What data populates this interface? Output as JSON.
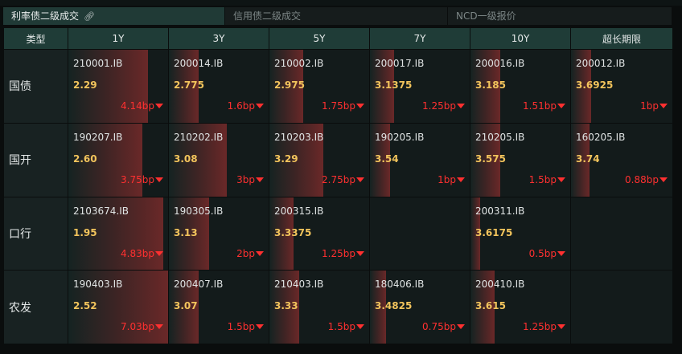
{
  "tabs": [
    {
      "label": "利率债二级成交",
      "active": true
    },
    {
      "label": "信用债二级成交",
      "active": false
    },
    {
      "label": "NCD一级报价",
      "active": false
    }
  ],
  "columns": [
    "类型",
    "1Y",
    "3Y",
    "5Y",
    "7Y",
    "10Y",
    "超长期限"
  ],
  "rows": [
    {
      "type": "国债",
      "cells": [
        {
          "code": "210001.IB",
          "yield": "2.29",
          "change": "4.14bp",
          "fill": 0.8
        },
        {
          "code": "200014.IB",
          "yield": "2.775",
          "change": "1.6bp",
          "fill": 0.3
        },
        {
          "code": "210002.IB",
          "yield": "2.975",
          "change": "1.75bp",
          "fill": 0.34
        },
        {
          "code": "200017.IB",
          "yield": "3.1375",
          "change": "1.25bp",
          "fill": 0.24
        },
        {
          "code": "200016.IB",
          "yield": "3.185",
          "change": "1.51bp",
          "fill": 0.3
        },
        {
          "code": "200012.IB",
          "yield": "3.6925",
          "change": "1bp",
          "fill": 0.2
        }
      ]
    },
    {
      "type": "国开",
      "cells": [
        {
          "code": "190207.IB",
          "yield": "2.60",
          "change": "3.75bp",
          "fill": 0.74
        },
        {
          "code": "210202.IB",
          "yield": "3.08",
          "change": "3bp",
          "fill": 0.58
        },
        {
          "code": "210203.IB",
          "yield": "3.29",
          "change": "2.75bp",
          "fill": 0.54
        },
        {
          "code": "190205.IB",
          "yield": "3.54",
          "change": "1bp",
          "fill": 0.2
        },
        {
          "code": "210205.IB",
          "yield": "3.575",
          "change": "1.5bp",
          "fill": 0.3
        },
        {
          "code": "160205.IB",
          "yield": "3.74",
          "change": "0.88bp",
          "fill": 0.18
        }
      ]
    },
    {
      "type": "口行",
      "cells": [
        {
          "code": "2103674.IB",
          "yield": "1.95",
          "change": "4.83bp",
          "fill": 0.95
        },
        {
          "code": "190305.IB",
          "yield": "3.13",
          "change": "2bp",
          "fill": 0.4
        },
        {
          "code": "200315.IB",
          "yield": "3.3375",
          "change": "1.25bp",
          "fill": 0.24
        },
        null,
        {
          "code": "200311.IB",
          "yield": "3.6175",
          "change": "0.5bp",
          "fill": 0.1
        },
        null
      ]
    },
    {
      "type": "农发",
      "cells": [
        {
          "code": "190403.IB",
          "yield": "2.52",
          "change": "7.03bp",
          "fill": 1.0
        },
        {
          "code": "200407.IB",
          "yield": "3.07",
          "change": "1.5bp",
          "fill": 0.3
        },
        {
          "code": "210403.IB",
          "yield": "3.33",
          "change": "1.5bp",
          "fill": 0.3
        },
        {
          "code": "180406.IB",
          "yield": "3.4825",
          "change": "0.75bp",
          "fill": 0.16
        },
        {
          "code": "200410.IB",
          "yield": "3.615",
          "change": "1.25bp",
          "fill": 0.24
        },
        null
      ]
    }
  ]
}
